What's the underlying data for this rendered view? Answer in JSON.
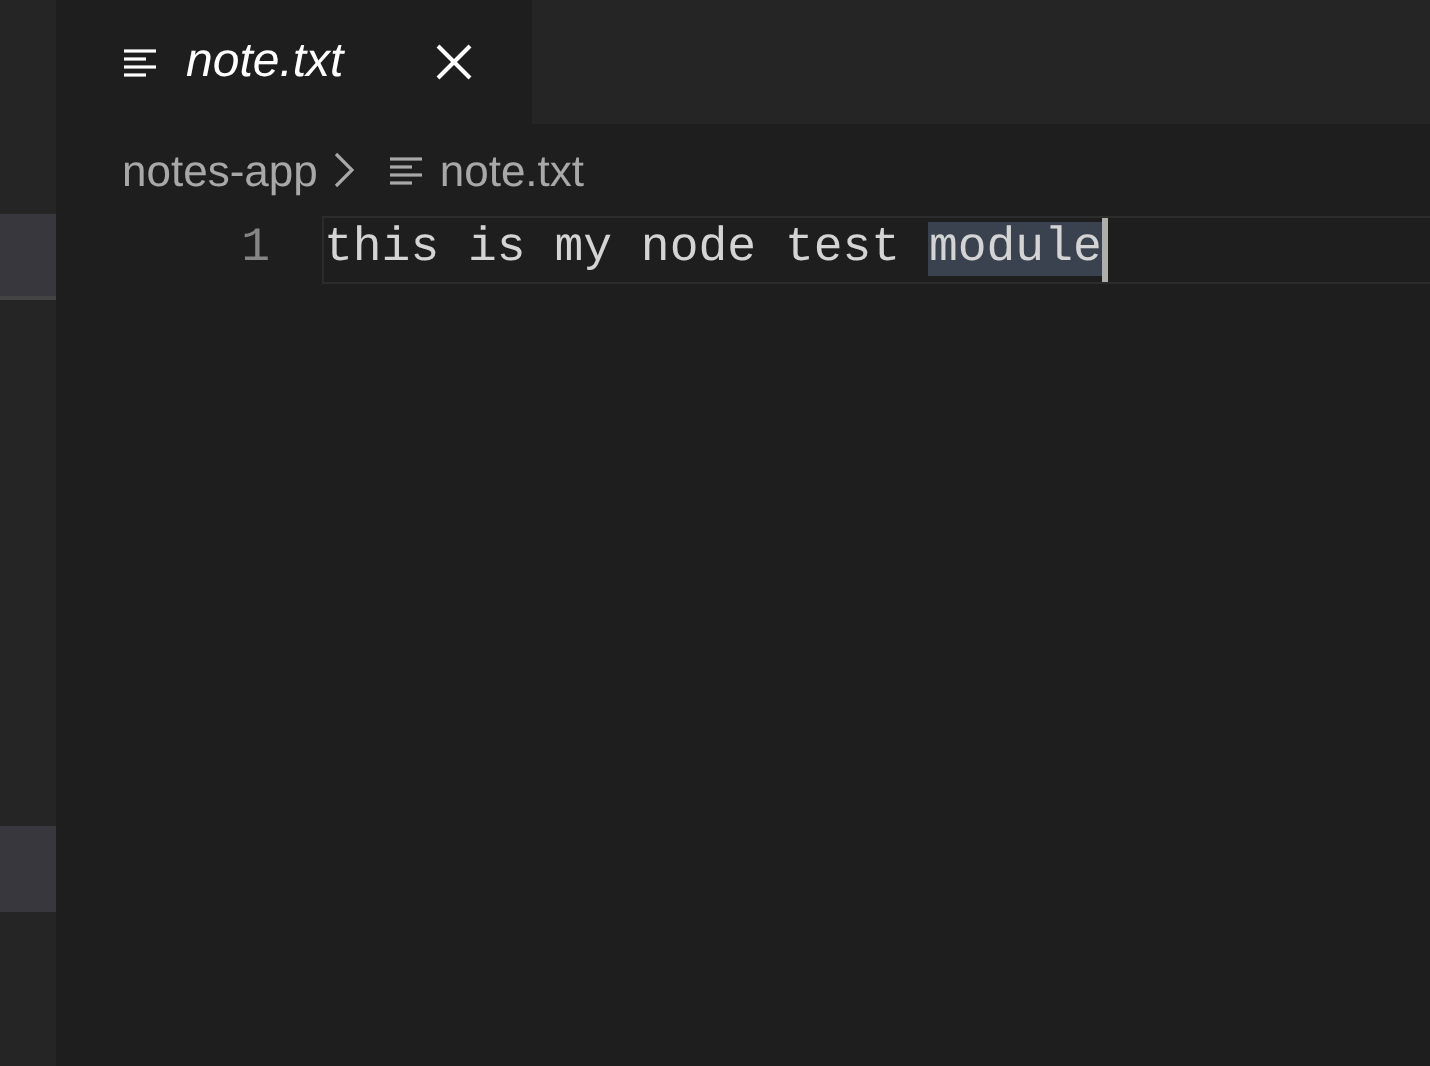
{
  "tab": {
    "label": "note.txt",
    "selected": true,
    "preview": true
  },
  "breadcrumb": [
    {
      "label": "notes-app",
      "kind": "folder"
    },
    {
      "label": "note.txt",
      "kind": "file"
    }
  ],
  "editor": {
    "lines": [
      {
        "number": "1",
        "current": true,
        "cursor": true,
        "segments": [
          {
            "text": "this is my node test ",
            "selected": false
          },
          {
            "text": "module",
            "selected": true
          }
        ]
      }
    ]
  }
}
